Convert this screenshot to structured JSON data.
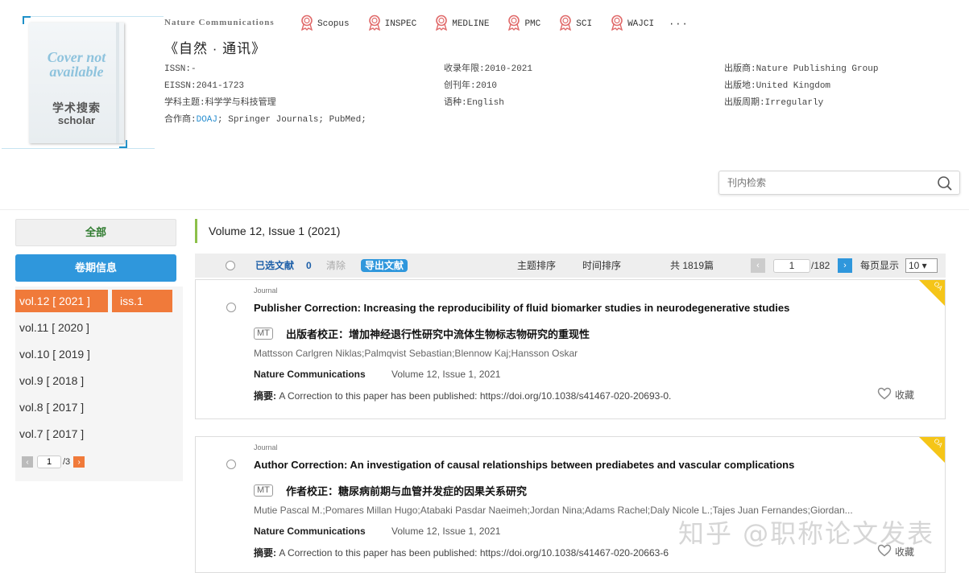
{
  "cover": {
    "line1": "Cover not",
    "line2": "available",
    "logo_cn": "学术搜索",
    "logo_en": "scholar"
  },
  "journal": {
    "name_en": "Nature Communications",
    "name_cn": "《自然 · 通讯》"
  },
  "indexes": [
    "Scopus",
    "INSPEC",
    "MEDLINE",
    "PMC",
    "SCI",
    "WAJCI"
  ],
  "indexes_more": "···",
  "meta": {
    "col1": [
      "ISSN:-",
      "EISSN:2041-1723",
      "学科主题:科学学与科技管理"
    ],
    "partner_label": "合作商:",
    "partner_link": "DOAJ",
    "partner_rest": "; Springer Journals; PubMed;",
    "col2": [
      "收录年限:2010-2021",
      "创刊年:2010",
      "语种:English"
    ],
    "col3": [
      "出版商:Nature Publishing Group",
      "出版地:United Kingdom",
      "出版周期:Irregularly"
    ]
  },
  "search": {
    "placeholder": "刊内检索"
  },
  "sidebar": {
    "all_label": "全部",
    "volume_info_label": "卷期信息",
    "volumes": [
      "vol.12 [ 2021 ]",
      "vol.11 [ 2020 ]",
      "vol.10 [ 2019 ]",
      "vol.9 [ 2018 ]",
      "vol.8 [ 2017 ]",
      "vol.7 [ 2017 ]"
    ],
    "active_volume": 0,
    "issue": "iss.1",
    "pager": {
      "page": "1",
      "total": "/3"
    }
  },
  "main": {
    "volume_title": "Volume 12, Issue 1 (2021)",
    "toolbar": {
      "selected_label": "已选文献",
      "selected_count": "0",
      "clear": "清除",
      "export": "导出文献",
      "sort_topic": "主题排序",
      "sort_time": "时间排序",
      "total": "共 1819篇",
      "page": "1",
      "page_total": "/182",
      "per_page_label": "每页显示",
      "per_page": "10 ▾"
    },
    "articles": [
      {
        "type": "Journal",
        "title": "Publisher Correction: Increasing the reproducibility of fluid biomarker studies in neurodegenerative studies",
        "mt": "MT",
        "title_cn": "出版者校正：增加神经退行性研究中流体生物标志物研究的重现性",
        "authors": "Mattsson Carlgren Niklas;Palmqvist Sebastian;Blennow Kaj;Hansson Oskar",
        "journal": "Nature Communications",
        "volume": "Volume 12, Issue 1, 2021",
        "abstract_label": "摘要:",
        "abstract": " A Correction to this paper has been published: https://doi.org/10.1038/s41467-020-20693-0.",
        "fav": "收藏",
        "oa": "OA"
      },
      {
        "type": "Journal",
        "title": "Author Correction: An investigation of causal relationships between prediabetes and vascular complications",
        "mt": "MT",
        "title_cn": "作者校正：糖尿病前期与血管并发症的因果关系研究",
        "authors": "Mutie Pascal M.;Pomares Millan Hugo;Atabaki Pasdar Naeimeh;Jordan Nina;Adams Rachel;Daly Nicole L.;Tajes Juan Fernandes;Giordan...",
        "journal": "Nature Communications",
        "volume": "Volume 12, Issue 1, 2021",
        "abstract_label": "摘要:",
        "abstract": " A Correction to this paper has been published: https://doi.org/10.1038/s41467-020-20663-6",
        "fav": "收藏",
        "oa": "OA"
      }
    ]
  },
  "watermark": "知乎 @职称论文发表",
  "colors": {
    "accent_blue": "#2f97dc",
    "active_orange": "#f07a3a",
    "oa_yellow": "#f5c518",
    "green_bar": "#8cc04a"
  }
}
